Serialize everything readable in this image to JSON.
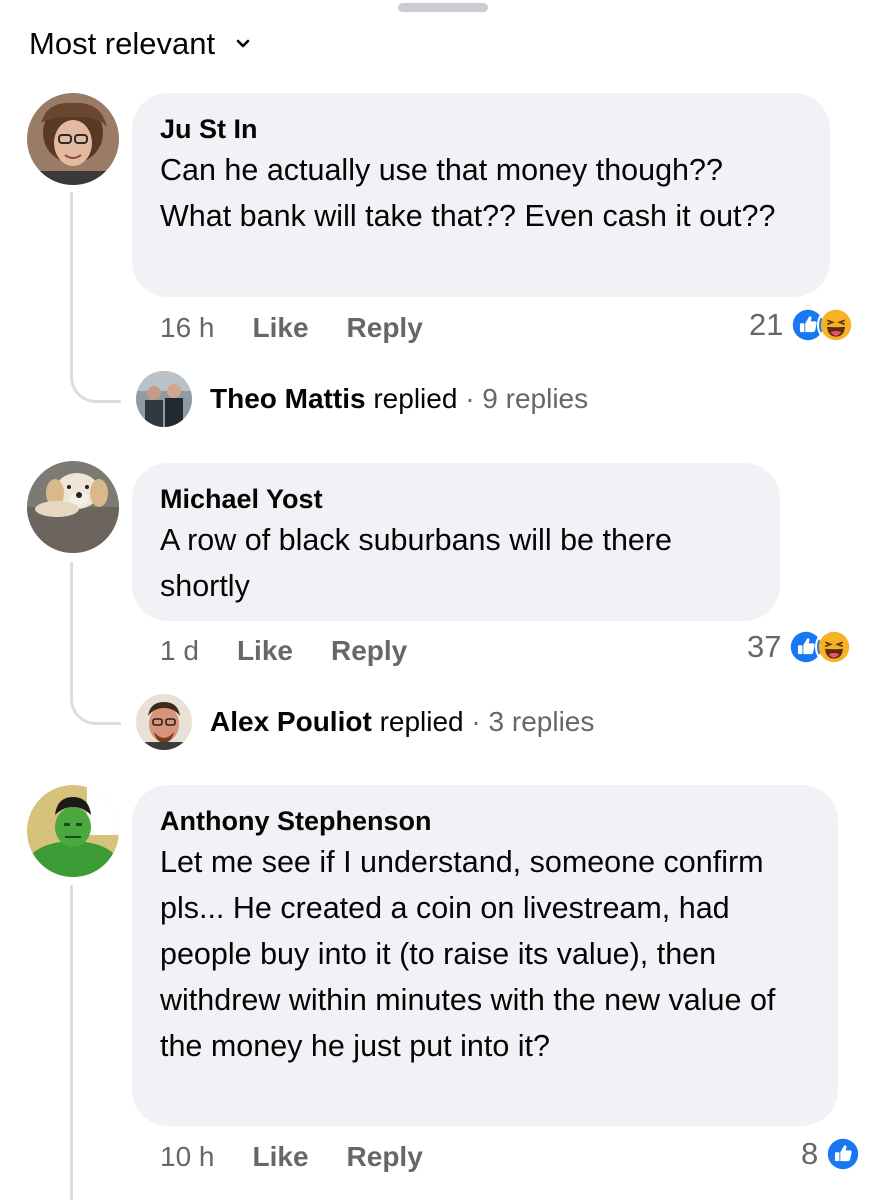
{
  "header": {
    "sort_label": "Most relevant"
  },
  "comments": [
    {
      "author": "Ju St In",
      "text": "Can he actually use that money though?? What bank will take that?? Even cash it out??",
      "time": "16 h",
      "like_label": "Like",
      "reply_label": "Reply",
      "reaction_count": "21",
      "reactions": [
        "like-icon",
        "haha-icon"
      ],
      "replies": {
        "name": "Theo Mattis",
        "verb": "replied",
        "separator": "·",
        "count_text": "9 replies"
      }
    },
    {
      "author": "Michael Yost",
      "text": "A row of black suburbans will be there shortly",
      "time": "1 d",
      "like_label": "Like",
      "reply_label": "Reply",
      "reaction_count": "37",
      "reactions": [
        "like-icon",
        "haha-icon"
      ],
      "replies": {
        "name": "Alex Pouliot",
        "verb": "replied",
        "separator": "·",
        "count_text": "3 replies"
      }
    },
    {
      "author": "Anthony Stephenson",
      "text": "Let me see if I understand, someone confirm pls... He created a coin on livestream, had people buy into it (to raise its value), then withdrew within minutes with the new value of the money he just put into it?",
      "time": "10 h",
      "like_label": "Like",
      "reply_label": "Reply",
      "reaction_count": "8",
      "reactions": [
        "like-icon"
      ]
    }
  ],
  "colors": {
    "bubble": "#f0f2f5",
    "meta_text": "#65676b",
    "like_blue": "#1877f2",
    "haha_yellow": "#f7b125",
    "thread_line": "#dadde1"
  }
}
